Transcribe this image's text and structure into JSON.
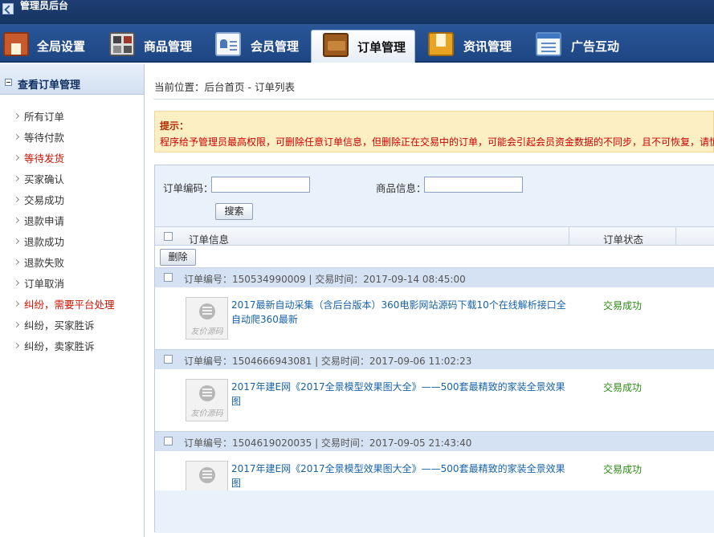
{
  "window": {
    "title": "管理员后台"
  },
  "nav": {
    "tabs": [
      {
        "label": "全局设置",
        "icon": "home-icon"
      },
      {
        "label": "商品管理",
        "icon": "grid-icon"
      },
      {
        "label": "会员管理",
        "icon": "card-icon"
      },
      {
        "label": "订单管理",
        "icon": "wallet-icon"
      },
      {
        "label": "资讯管理",
        "icon": "news-icon"
      },
      {
        "label": "广告互动",
        "icon": "ad-icon"
      }
    ]
  },
  "sidebar": {
    "title": "查看订单管理",
    "items": [
      {
        "label": "所有订单",
        "highlight": false
      },
      {
        "label": "等待付款",
        "highlight": false
      },
      {
        "label": "等待发货",
        "highlight": true
      },
      {
        "label": "买家确认",
        "highlight": false
      },
      {
        "label": "交易成功",
        "highlight": false
      },
      {
        "label": "退款申请",
        "highlight": false
      },
      {
        "label": "退款成功",
        "highlight": false
      },
      {
        "label": "退款失败",
        "highlight": false
      },
      {
        "label": "订单取消",
        "highlight": false
      },
      {
        "label": "纠纷，需要平台处理",
        "highlight": true
      },
      {
        "label": "纠纷，买家胜诉",
        "highlight": false
      },
      {
        "label": "纠纷，卖家胜诉",
        "highlight": false
      }
    ]
  },
  "breadcrumb": "当前位置：后台首页 - 订单列表",
  "tip": {
    "title": "提示：",
    "text": "程序给予管理员最高权限，可删除任意订单信息，但删除正在交易中的订单，可能会引起会员资金数据的不同步，且不可恢复，请慎"
  },
  "search": {
    "order_no_label": "订单编码：",
    "product_label": "商品信息：",
    "button": "搜索"
  },
  "table": {
    "col_info": "订单信息",
    "col_status": "订单状态",
    "delete_button": "删除"
  },
  "orders": [
    {
      "head": "订单编号：150534990009 | 交易时间：2017-09-14 08:45:00",
      "product": "2017最新自动采集（含后台版本）360电影网站源码下载10个在线解析接口全自动爬360最新",
      "status": "交易成功"
    },
    {
      "head": "订单编号：1504666943081 | 交易时间：2017-09-06 11:02:23",
      "product": "2017年建E网《2017全景模型效果图大全》——500套最精致的家装全景效果图",
      "status": "交易成功"
    },
    {
      "head": "订单编号：1504619020035 | 交易时间：2017-09-05 21:43:40",
      "product": "2017年建E网《2017全景模型效果图大全》——500套最精致的家装全景效果图",
      "status": "交易成功"
    }
  ],
  "thumb_watermark": "友价源码"
}
